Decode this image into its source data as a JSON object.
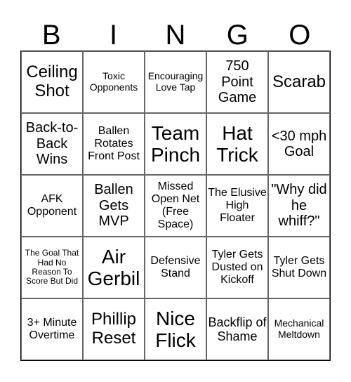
{
  "header": {
    "letters": [
      "B",
      "I",
      "N",
      "G",
      "O"
    ]
  },
  "cells": [
    "Ceiling Shot",
    "Toxic Opponents",
    "Encouraging Love Tap",
    "750 Point Game",
    "Scarab",
    "Back-to-Back Wins",
    "Ballen Rotates Front Post",
    "Team Pinch",
    "Hat Trick",
    "<30 mph Goal",
    "AFK Opponent",
    "Ballen Gets MVP",
    "Missed Open Net (Free Space)",
    "The Elusive High Floater",
    "\"Why did he whiff?\"",
    "The Goal That Had No Reason To Score But Did",
    "Air Gerbil",
    "Defensive Stand",
    "Tyler Gets Dusted on Kickoff",
    "Tyler Gets Shut Down",
    "3+ Minute Overtime",
    "Phillip Reset",
    "Nice Flick",
    "Backflip of Shame",
    "Mechanical Meltdown"
  ]
}
